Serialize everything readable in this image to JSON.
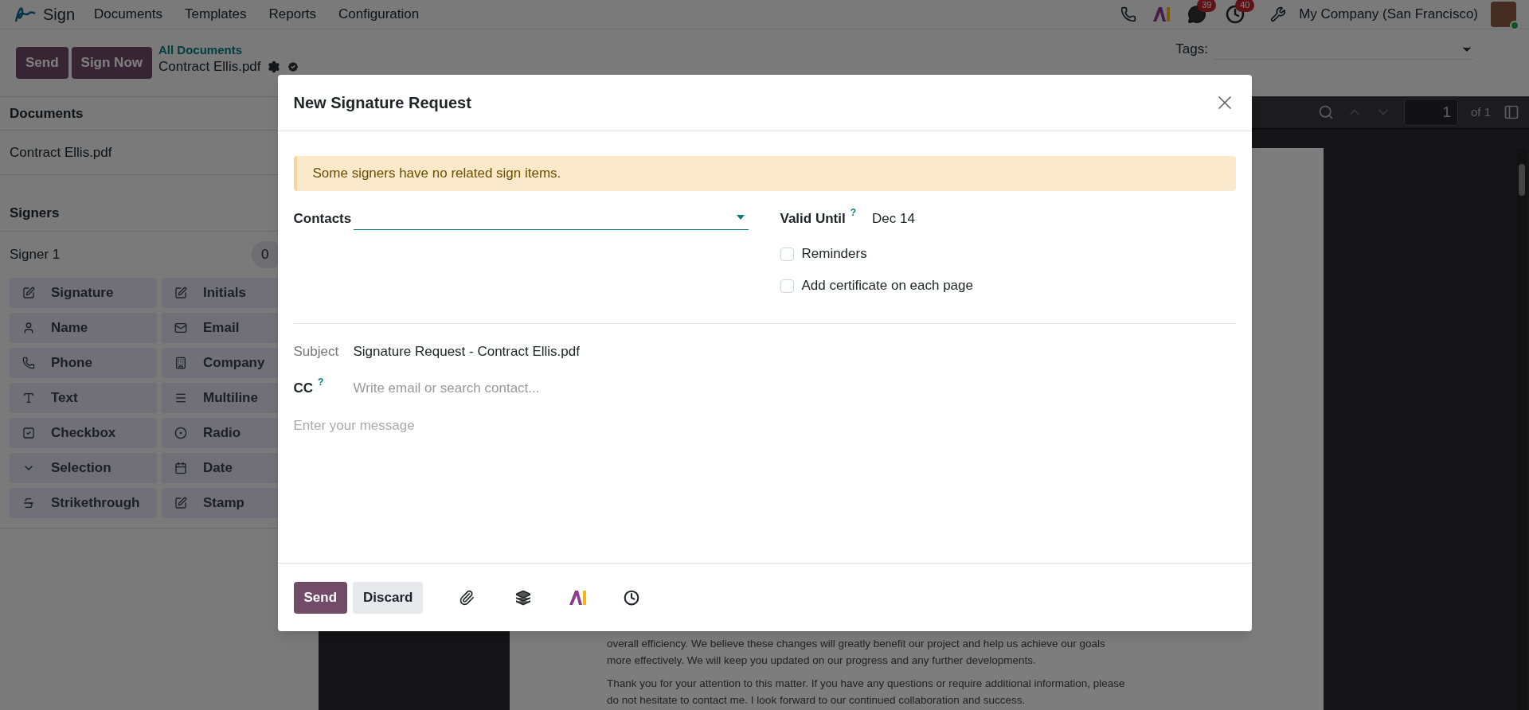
{
  "nav": {
    "app_name": "Sign",
    "menu": [
      "Documents",
      "Templates",
      "Reports",
      "Configuration"
    ],
    "chat_count": "39",
    "activity_count": "40",
    "company": "My Company (San Francisco)"
  },
  "control_bar": {
    "buttons": [
      "Send",
      "Sign Now"
    ],
    "breadcrumb": "All Documents",
    "document": "Contract Ellis.pdf",
    "tags_label": "Tags:"
  },
  "sidebar": {
    "documents_title": "Documents",
    "documents": [
      "Contract Ellis.pdf"
    ],
    "signers_title": "Signers",
    "signers": [
      {
        "name": "Signer 1",
        "count": "0"
      }
    ],
    "items": [
      {
        "label": "Signature",
        "kind": "signature"
      },
      {
        "label": "Initials",
        "kind": "initials"
      },
      {
        "label": "Name",
        "kind": "name"
      },
      {
        "label": "Email",
        "kind": "email"
      },
      {
        "label": "Phone",
        "kind": "phone"
      },
      {
        "label": "Company",
        "kind": "company"
      },
      {
        "label": "Text",
        "kind": "text"
      },
      {
        "label": "Multiline",
        "kind": "multiline"
      },
      {
        "label": "Checkbox",
        "kind": "checkbox"
      },
      {
        "label": "Radio",
        "kind": "radio"
      },
      {
        "label": "Selection",
        "kind": "selection"
      },
      {
        "label": "Date",
        "kind": "date"
      },
      {
        "label": "Strikethrough",
        "kind": "strikethrough"
      },
      {
        "label": "Stamp",
        "kind": "stamp"
      }
    ]
  },
  "viewer": {
    "page": "1",
    "page_total": "of 1",
    "paragraphs": [
      [
        "overall efficiency. We believe these changes will greatly benefit our project and help us achieve our goals",
        "more effectively. We will keep you updated on our progress and any further developments."
      ],
      [
        "Thank you for your attention to this matter. If you have any questions or require additional information, please",
        "do not hesitate to contact me. I look forward to our continued collaboration and success."
      ]
    ]
  },
  "dialog": {
    "title": "New Signature Request",
    "warning": "Some signers have no related sign items.",
    "contacts_label": "Contacts",
    "valid_until_label": "Valid Until",
    "valid_until_help": "?",
    "valid_until": "Dec 14",
    "options": [
      {
        "label": "Reminders",
        "checked": false
      },
      {
        "label": "Add certificate on each page",
        "checked": false
      }
    ],
    "subject_label": "Subject",
    "subject": "Signature Request - Contract Ellis.pdf",
    "cc_label": "CC",
    "cc_help": "?",
    "cc_placeholder": "Write email or search contact...",
    "message_placeholder": "Enter your message",
    "buttons": [
      {
        "label": "Send",
        "kind": "primary"
      },
      {
        "label": "Discard",
        "kind": "secondary"
      }
    ]
  }
}
